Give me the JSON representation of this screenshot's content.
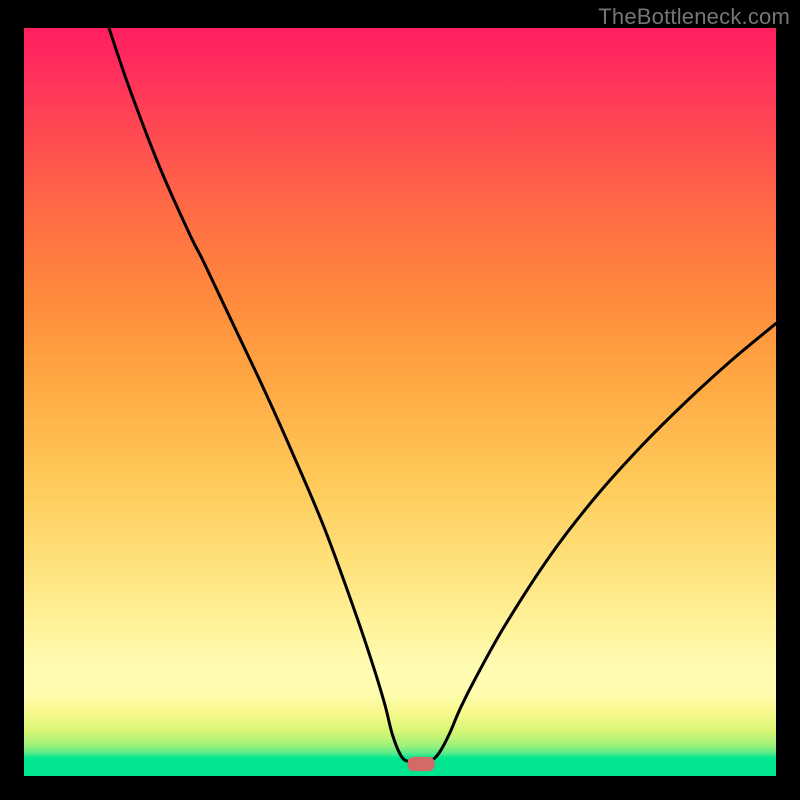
{
  "watermark": "TheBottleneck.com",
  "colors": {
    "frame_background": "#000000",
    "gradient_top": "#ff1f60",
    "gradient_bottom": "#01e58f",
    "curve_stroke": "#000000",
    "marker_fill": "#d36a67",
    "watermark_text": "#757575"
  },
  "chart_data": {
    "type": "line",
    "title": "",
    "xlabel": "",
    "ylabel": "",
    "xlim": [
      0,
      100
    ],
    "ylim": [
      0,
      100
    ],
    "grid": false,
    "legend": false,
    "note": "Axes are unlabeled in the image. x normalized 0–100 left→right across the gradient area, y normalized 0–100 bottom→top. Values estimated from pixel positions.",
    "series": [
      {
        "name": "bottleneck-curve",
        "x": [
          11.3,
          14.0,
          18.0,
          22.0,
          24.0,
          28.0,
          32.0,
          36.0,
          40.0,
          44.0,
          46.5,
          48.0,
          49.0,
          50.2,
          51.3,
          52.3,
          53.4,
          54.5,
          55.4,
          56.6,
          58.0,
          60.0,
          64.0,
          70.0,
          76.0,
          82.0,
          88.0,
          94.0,
          100.0
        ],
        "y": [
          100.0,
          92.0,
          81.5,
          72.5,
          68.5,
          60.0,
          51.5,
          42.5,
          33.0,
          22.0,
          14.5,
          9.5,
          5.5,
          2.6,
          1.9,
          1.8,
          1.85,
          2.3,
          3.4,
          5.7,
          9.0,
          13.0,
          20.2,
          29.5,
          37.3,
          44.0,
          50.0,
          55.5,
          60.5
        ]
      }
    ],
    "markers": [
      {
        "name": "minimum-marker",
        "shape": "rounded-rect",
        "x": 52.8,
        "y": 1.6,
        "width_pct": 3.6,
        "height_pct": 1.9
      }
    ]
  }
}
